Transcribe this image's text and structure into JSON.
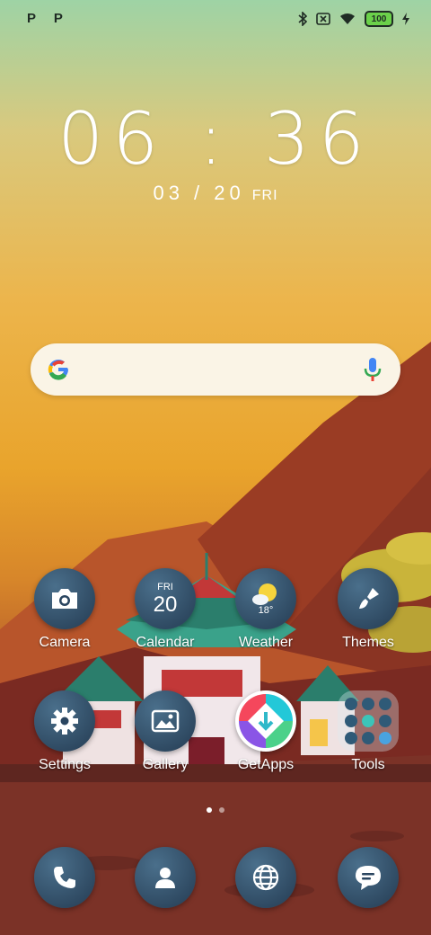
{
  "status": {
    "left_text": "P P",
    "battery": "100"
  },
  "clock": {
    "time": "06 : 36",
    "date": "03 / 20",
    "day": "FRI"
  },
  "apps_row1": [
    {
      "label": "Camera"
    },
    {
      "label": "Calendar",
      "cal_day": "FRI",
      "cal_date": "20"
    },
    {
      "label": "Weather",
      "temp": "18°"
    },
    {
      "label": "Themes"
    }
  ],
  "apps_row2": [
    {
      "label": "Settings"
    },
    {
      "label": "Gallery"
    },
    {
      "label": "GetApps"
    },
    {
      "label": "Tools"
    }
  ],
  "dock": [
    {
      "name": "phone"
    },
    {
      "name": "contacts"
    },
    {
      "name": "browser"
    },
    {
      "name": "messages"
    }
  ],
  "page_indicator": {
    "pages": 2,
    "current": 1
  }
}
